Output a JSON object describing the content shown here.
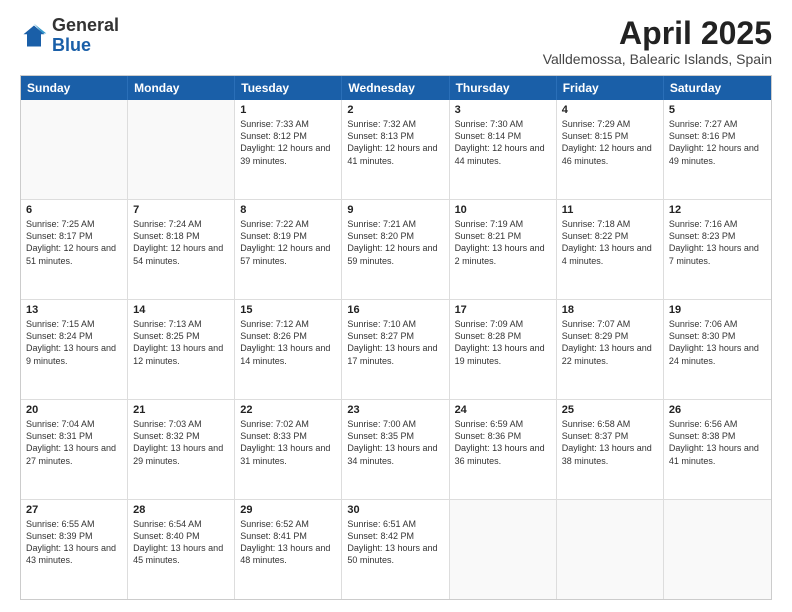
{
  "header": {
    "logo": {
      "general": "General",
      "blue": "Blue"
    },
    "title": "April 2025",
    "location": "Valldemossa, Balearic Islands, Spain"
  },
  "days_of_week": [
    "Sunday",
    "Monday",
    "Tuesday",
    "Wednesday",
    "Thursday",
    "Friday",
    "Saturday"
  ],
  "weeks": [
    [
      {
        "day": "",
        "empty": true
      },
      {
        "day": "",
        "empty": true
      },
      {
        "day": "1",
        "sunrise": "Sunrise: 7:33 AM",
        "sunset": "Sunset: 8:12 PM",
        "daylight": "Daylight: 12 hours and 39 minutes."
      },
      {
        "day": "2",
        "sunrise": "Sunrise: 7:32 AM",
        "sunset": "Sunset: 8:13 PM",
        "daylight": "Daylight: 12 hours and 41 minutes."
      },
      {
        "day": "3",
        "sunrise": "Sunrise: 7:30 AM",
        "sunset": "Sunset: 8:14 PM",
        "daylight": "Daylight: 12 hours and 44 minutes."
      },
      {
        "day": "4",
        "sunrise": "Sunrise: 7:29 AM",
        "sunset": "Sunset: 8:15 PM",
        "daylight": "Daylight: 12 hours and 46 minutes."
      },
      {
        "day": "5",
        "sunrise": "Sunrise: 7:27 AM",
        "sunset": "Sunset: 8:16 PM",
        "daylight": "Daylight: 12 hours and 49 minutes."
      }
    ],
    [
      {
        "day": "6",
        "sunrise": "Sunrise: 7:25 AM",
        "sunset": "Sunset: 8:17 PM",
        "daylight": "Daylight: 12 hours and 51 minutes."
      },
      {
        "day": "7",
        "sunrise": "Sunrise: 7:24 AM",
        "sunset": "Sunset: 8:18 PM",
        "daylight": "Daylight: 12 hours and 54 minutes."
      },
      {
        "day": "8",
        "sunrise": "Sunrise: 7:22 AM",
        "sunset": "Sunset: 8:19 PM",
        "daylight": "Daylight: 12 hours and 57 minutes."
      },
      {
        "day": "9",
        "sunrise": "Sunrise: 7:21 AM",
        "sunset": "Sunset: 8:20 PM",
        "daylight": "Daylight: 12 hours and 59 minutes."
      },
      {
        "day": "10",
        "sunrise": "Sunrise: 7:19 AM",
        "sunset": "Sunset: 8:21 PM",
        "daylight": "Daylight: 13 hours and 2 minutes."
      },
      {
        "day": "11",
        "sunrise": "Sunrise: 7:18 AM",
        "sunset": "Sunset: 8:22 PM",
        "daylight": "Daylight: 13 hours and 4 minutes."
      },
      {
        "day": "12",
        "sunrise": "Sunrise: 7:16 AM",
        "sunset": "Sunset: 8:23 PM",
        "daylight": "Daylight: 13 hours and 7 minutes."
      }
    ],
    [
      {
        "day": "13",
        "sunrise": "Sunrise: 7:15 AM",
        "sunset": "Sunset: 8:24 PM",
        "daylight": "Daylight: 13 hours and 9 minutes."
      },
      {
        "day": "14",
        "sunrise": "Sunrise: 7:13 AM",
        "sunset": "Sunset: 8:25 PM",
        "daylight": "Daylight: 13 hours and 12 minutes."
      },
      {
        "day": "15",
        "sunrise": "Sunrise: 7:12 AM",
        "sunset": "Sunset: 8:26 PM",
        "daylight": "Daylight: 13 hours and 14 minutes."
      },
      {
        "day": "16",
        "sunrise": "Sunrise: 7:10 AM",
        "sunset": "Sunset: 8:27 PM",
        "daylight": "Daylight: 13 hours and 17 minutes."
      },
      {
        "day": "17",
        "sunrise": "Sunrise: 7:09 AM",
        "sunset": "Sunset: 8:28 PM",
        "daylight": "Daylight: 13 hours and 19 minutes."
      },
      {
        "day": "18",
        "sunrise": "Sunrise: 7:07 AM",
        "sunset": "Sunset: 8:29 PM",
        "daylight": "Daylight: 13 hours and 22 minutes."
      },
      {
        "day": "19",
        "sunrise": "Sunrise: 7:06 AM",
        "sunset": "Sunset: 8:30 PM",
        "daylight": "Daylight: 13 hours and 24 minutes."
      }
    ],
    [
      {
        "day": "20",
        "sunrise": "Sunrise: 7:04 AM",
        "sunset": "Sunset: 8:31 PM",
        "daylight": "Daylight: 13 hours and 27 minutes."
      },
      {
        "day": "21",
        "sunrise": "Sunrise: 7:03 AM",
        "sunset": "Sunset: 8:32 PM",
        "daylight": "Daylight: 13 hours and 29 minutes."
      },
      {
        "day": "22",
        "sunrise": "Sunrise: 7:02 AM",
        "sunset": "Sunset: 8:33 PM",
        "daylight": "Daylight: 13 hours and 31 minutes."
      },
      {
        "day": "23",
        "sunrise": "Sunrise: 7:00 AM",
        "sunset": "Sunset: 8:35 PM",
        "daylight": "Daylight: 13 hours and 34 minutes."
      },
      {
        "day": "24",
        "sunrise": "Sunrise: 6:59 AM",
        "sunset": "Sunset: 8:36 PM",
        "daylight": "Daylight: 13 hours and 36 minutes."
      },
      {
        "day": "25",
        "sunrise": "Sunrise: 6:58 AM",
        "sunset": "Sunset: 8:37 PM",
        "daylight": "Daylight: 13 hours and 38 minutes."
      },
      {
        "day": "26",
        "sunrise": "Sunrise: 6:56 AM",
        "sunset": "Sunset: 8:38 PM",
        "daylight": "Daylight: 13 hours and 41 minutes."
      }
    ],
    [
      {
        "day": "27",
        "sunrise": "Sunrise: 6:55 AM",
        "sunset": "Sunset: 8:39 PM",
        "daylight": "Daylight: 13 hours and 43 minutes."
      },
      {
        "day": "28",
        "sunrise": "Sunrise: 6:54 AM",
        "sunset": "Sunset: 8:40 PM",
        "daylight": "Daylight: 13 hours and 45 minutes."
      },
      {
        "day": "29",
        "sunrise": "Sunrise: 6:52 AM",
        "sunset": "Sunset: 8:41 PM",
        "daylight": "Daylight: 13 hours and 48 minutes."
      },
      {
        "day": "30",
        "sunrise": "Sunrise: 6:51 AM",
        "sunset": "Sunset: 8:42 PM",
        "daylight": "Daylight: 13 hours and 50 minutes."
      },
      {
        "day": "",
        "empty": true
      },
      {
        "day": "",
        "empty": true
      },
      {
        "day": "",
        "empty": true
      }
    ]
  ]
}
